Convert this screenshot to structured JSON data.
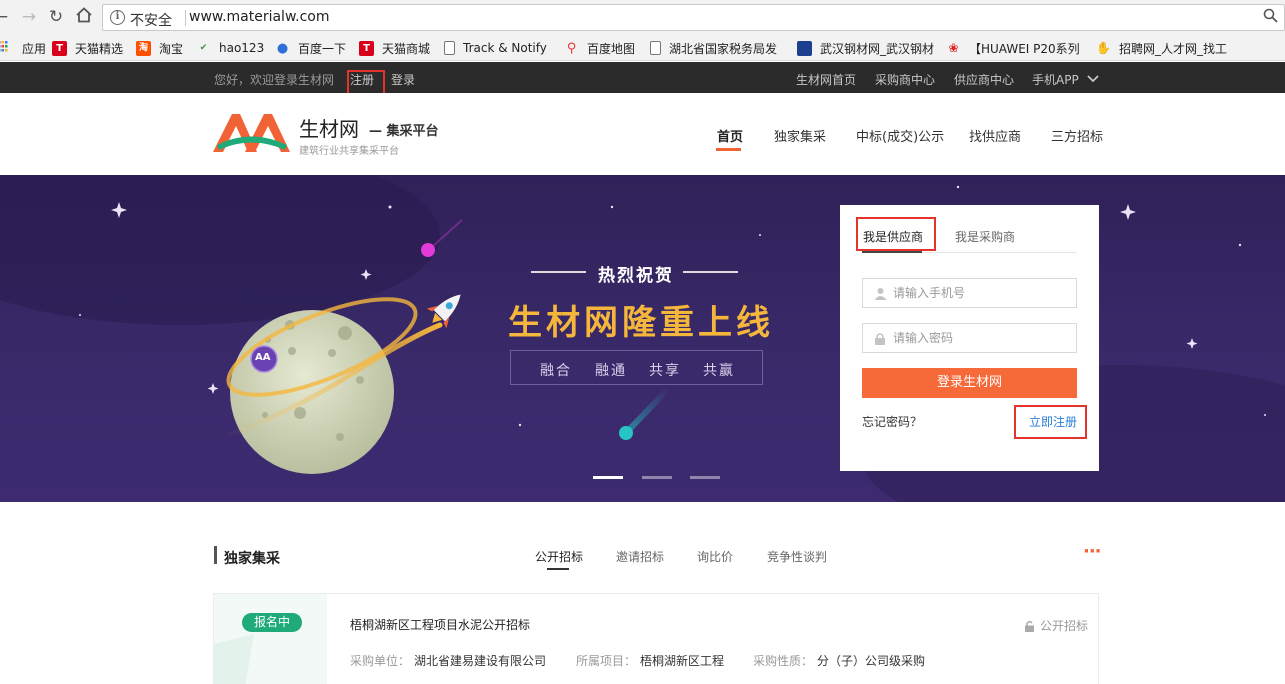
{
  "browser": {
    "insecure_label": "不安全",
    "url": "www.materialw.com"
  },
  "bookmarks": [
    {
      "label": "应用",
      "icon": "apps-grid-icon",
      "color": "#e8453c"
    },
    {
      "label": "天猫精选",
      "icon": "tmall-icon",
      "color": "#d9001b"
    },
    {
      "label": "淘宝",
      "icon": "taobao-icon",
      "color": "#ff5000"
    },
    {
      "label": "hao123",
      "icon": "hao123-icon",
      "color": "#3a9c36"
    },
    {
      "label": "百度一下",
      "icon": "baidu-paw-icon",
      "color": "#2f6fd8"
    },
    {
      "label": "天猫商城",
      "icon": "tmall-icon",
      "color": "#d9001b"
    },
    {
      "label": "Track & Notify",
      "icon": "page-icon",
      "color": "#ffffff"
    },
    {
      "label": "百度地图",
      "icon": "map-pin-icon",
      "color": "#e33"
    },
    {
      "label": "湖北省国家税务局发",
      "icon": "page-icon",
      "color": "#ffffff"
    },
    {
      "label": "武汉钢材网_武汉钢材",
      "icon": "site-icon",
      "color": "#1c3f8f"
    },
    {
      "label": "【HUAWEI P20系列",
      "icon": "huawei-icon",
      "color": "#e02020"
    },
    {
      "label": "招聘网_人才网_找工",
      "icon": "hand-icon",
      "color": "#2a5db0"
    }
  ],
  "topbar": {
    "welcome": "您好，欢迎登录生材网",
    "register": "注册",
    "login": "登录",
    "links": [
      "生材网首页",
      "采购商中心",
      "供应商中心",
      "手机APP"
    ]
  },
  "header": {
    "brand": "生材网",
    "brand_sub": "— 集采平台",
    "tagline": "建筑行业共享集采平台",
    "nav": [
      "首页",
      "独家集采",
      "中标(成交)公示",
      "找供应商",
      "三方招标"
    ],
    "active_nav": "首页"
  },
  "banner": {
    "heading": "热烈祝贺",
    "title": "生材网隆重上线",
    "items": [
      "融合",
      "融通",
      "共享",
      "共赢"
    ],
    "logo_text": "AA",
    "slides": 3,
    "active_slide": 1
  },
  "login": {
    "tab_supplier": "我是供应商",
    "tab_buyer": "我是采购商",
    "phone_placeholder": "请输入手机号",
    "password_placeholder": "请输入密码",
    "submit": "登录生材网",
    "forgot": "忘记密码？",
    "register": "立即注册"
  },
  "section": {
    "title": "独家集采",
    "tabs": [
      "公开招标",
      "邀请招标",
      "询比价",
      "竞争性谈判"
    ],
    "active_tab": "公开招标",
    "more": "···"
  },
  "card": {
    "status": "报名中",
    "title": "梧桐湖新区工程项目水泥公开招标",
    "type": "公开招标",
    "unit_label": "采购单位：",
    "unit": "湖北省建易建设有限公司",
    "project_label": "所属项目：",
    "project": "梧桐湖新区工程",
    "nature_label": "采购性质：",
    "nature": "分（子）公司级采购"
  },
  "colors": {
    "accent_orange": "#f66a3a",
    "brand_green": "#1eaa79",
    "banner_purple": "#342460",
    "banner_gold": "#f5b63c",
    "link_blue": "#2a7fd8",
    "highlight_red": "#e5322d"
  }
}
